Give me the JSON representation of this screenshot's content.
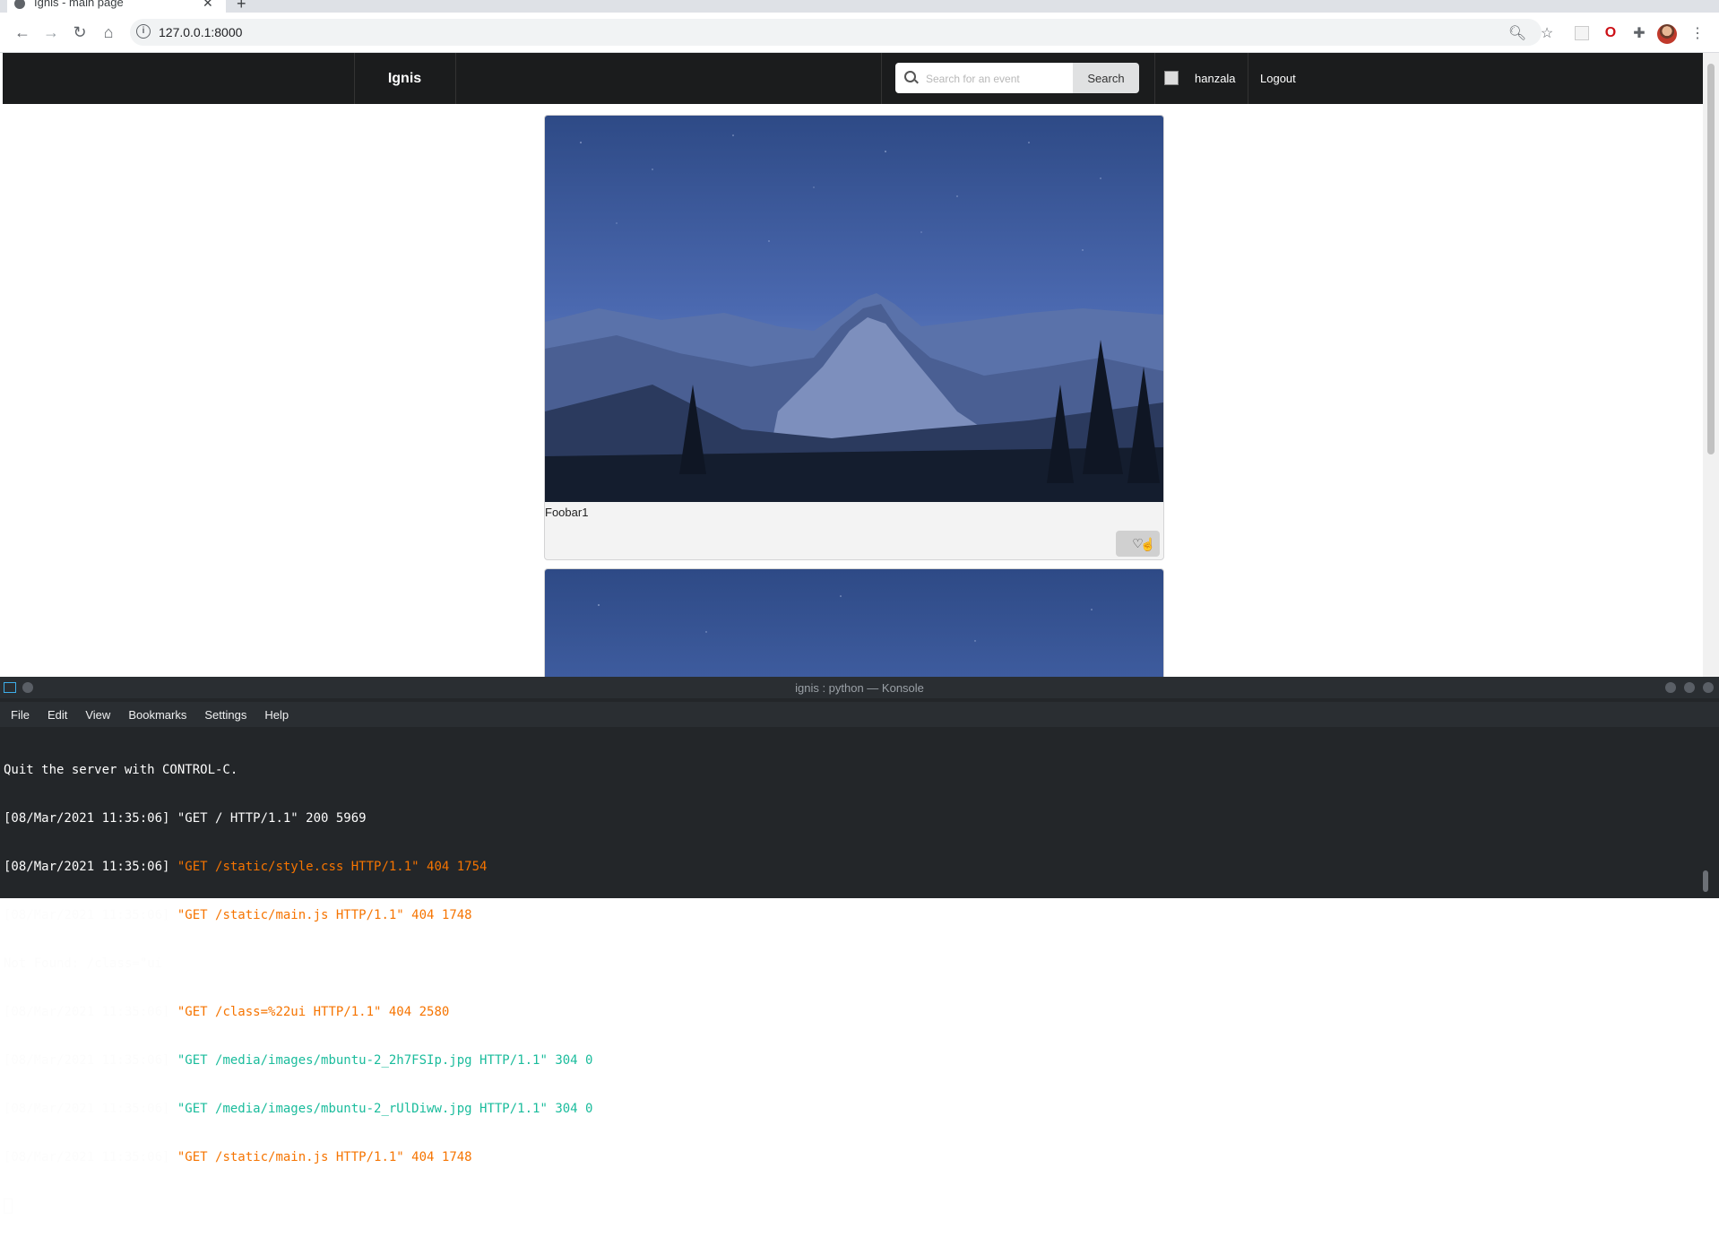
{
  "browser": {
    "tab_title": "Ignis - main page",
    "url": "127.0.0.1:8000"
  },
  "site": {
    "brand": "Ignis",
    "search": {
      "placeholder": "Search for an event",
      "button": "Search"
    },
    "user": {
      "name": "hanzala",
      "logout": "Logout"
    },
    "cards": [
      {
        "title": "Foobar1"
      },
      {
        "title": ""
      }
    ]
  },
  "konsole": {
    "title": "ignis : python — Konsole",
    "menu": [
      "File",
      "Edit",
      "View",
      "Bookmarks",
      "Settings",
      "Help"
    ],
    "lines": [
      {
        "text": "Quit the server with CONTROL-C.",
        "prefix": "",
        "highlight": "",
        "suffix": "",
        "color": ""
      },
      {
        "prefix": "[08/Mar/2021 11:35:06] ",
        "highlight": "\"GET / HTTP/1.1\" 200 5969",
        "suffix": "",
        "color": ""
      },
      {
        "prefix": "[08/Mar/2021 11:35:06] ",
        "highlight": "\"GET /static/style.css HTTP/1.1\"",
        "suffix": " 404 1754",
        "color": "#f67400"
      },
      {
        "prefix": "[08/Mar/2021 11:35:06] ",
        "highlight": "\"GET /static/main.js HTTP/1.1\"",
        "suffix": " 404 1748",
        "color": "#f67400"
      },
      {
        "text": "Not Found: /class=\"ui",
        "prefix": "",
        "highlight": "",
        "suffix": "",
        "color": ""
      },
      {
        "prefix": "[08/Mar/2021 11:35:06] ",
        "highlight": "\"GET /class=%22ui HTTP/1.1\"",
        "suffix": " 404 2580",
        "color": "#f67400"
      },
      {
        "prefix": "[08/Mar/2021 11:35:06] ",
        "highlight": "\"GET /media/images/mbuntu-2_2h7FSIp.jpg HTTP/1.1\"",
        "suffix": " 304 0",
        "color": "#1abc9c"
      },
      {
        "prefix": "[08/Mar/2021 11:35:06] ",
        "highlight": "\"GET /media/images/mbuntu-2_rUlDiww.jpg HTTP/1.1\"",
        "suffix": " 304 0",
        "color": "#1abc9c"
      },
      {
        "prefix": "[08/Mar/2021 11:35:06] ",
        "highlight": "\"GET /static/main.js HTTP/1.1\"",
        "suffix": " 404 1748",
        "color": "#f67400"
      }
    ]
  }
}
